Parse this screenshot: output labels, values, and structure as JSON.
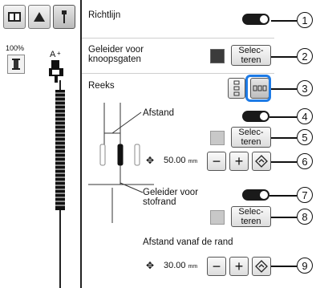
{
  "left": {
    "zoom": "100%"
  },
  "rows": {
    "richtlijn": {
      "label": "Richtlijn"
    },
    "geleider_knoopsgaten": {
      "label_line1": "Geleider voor",
      "label_line2": "knoopsgaten",
      "button_line1": "Selec-",
      "button_line2": "teren",
      "swatch_color": "#3b3b3b"
    },
    "reeks": {
      "label": "Reeks"
    },
    "afstand": {
      "label": "Afstand",
      "button_line1": "Selec-",
      "button_line2": "teren",
      "swatch_color": "#c8c8c8",
      "value": "50.00",
      "unit": "mm"
    },
    "stofrand": {
      "label_line1": "Geleider voor",
      "label_line2": "stofrand",
      "button_line1": "Selec-",
      "button_line2": "teren",
      "swatch_color": "#c8c8c8"
    },
    "afstand_rand": {
      "label": "Afstand vanaf de rand",
      "value": "30.00",
      "unit": "mm"
    }
  },
  "buttons": {
    "minus": "−",
    "plus": "+"
  },
  "callouts": [
    "1",
    "2",
    "3",
    "4",
    "5",
    "6",
    "7",
    "8",
    "9"
  ],
  "colors": {
    "highlight": "#1e7be6",
    "toggle_on": "#1a1a1a"
  }
}
